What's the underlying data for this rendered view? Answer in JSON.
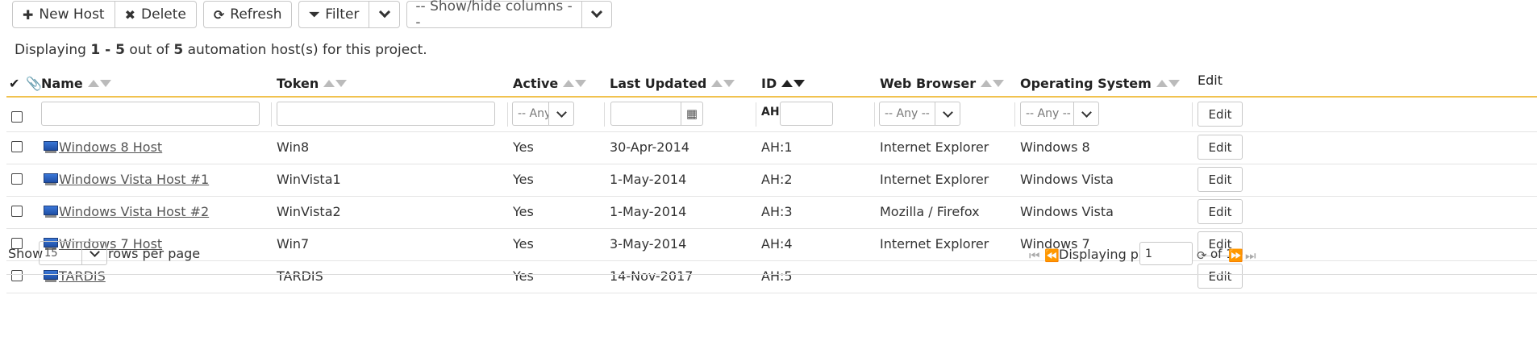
{
  "toolbar": {
    "new_host": "New Host",
    "delete": "Delete",
    "refresh": "Refresh",
    "filter": "Filter",
    "columns_select": "-- Show/hide columns --"
  },
  "summary": {
    "prefix": "Displaying",
    "range": "1 - 5",
    "middle": "out of",
    "total": "5",
    "suffix": "automation host(s) for this project."
  },
  "columns": {
    "name": "Name",
    "token": "Token",
    "active": "Active",
    "last_updated": "Last Updated",
    "id": "ID",
    "web_browser": "Web Browser",
    "os": "Operating System",
    "edit": "Edit"
  },
  "filters": {
    "active": "-- Any --",
    "id_prefix": "AH",
    "web_browser": "-- Any --",
    "os": "-- Any --",
    "edit_label": "Edit"
  },
  "rows": [
    {
      "name": "Windows 8 Host",
      "token": "Win8",
      "active": "Yes",
      "updated": "30-Apr-2014",
      "id": "AH:1",
      "browser": "Internet Explorer",
      "os": "Windows 8",
      "edit": "Edit"
    },
    {
      "name": "Windows Vista Host #1",
      "token": "WinVista1",
      "active": "Yes",
      "updated": "1-May-2014",
      "id": "AH:2",
      "browser": "Internet Explorer",
      "os": "Windows Vista",
      "edit": "Edit"
    },
    {
      "name": "Windows Vista Host #2",
      "token": "WinVista2",
      "active": "Yes",
      "updated": "1-May-2014",
      "id": "AH:3",
      "browser": "Mozilla / Firefox",
      "os": "Windows Vista",
      "edit": "Edit"
    },
    {
      "name": "Windows 7 Host",
      "token": "Win7",
      "active": "Yes",
      "updated": "3-May-2014",
      "id": "AH:4",
      "browser": "Internet Explorer",
      "os": "Windows 7",
      "edit": "Edit"
    },
    {
      "name": "TARDIS",
      "token": "TARDIS",
      "active": "Yes",
      "updated": "14-Nov-2017",
      "id": "AH:5",
      "browser": "",
      "os": "",
      "edit": "Edit"
    }
  ],
  "footer": {
    "show": "Show",
    "page_size": "15",
    "rows_per_page": "rows per page",
    "displaying_page": "Displaying page",
    "page": "1",
    "of": "of 1"
  },
  "colors": {
    "header_rule": "#f1c24f",
    "host_icon": "#2f62c2"
  }
}
